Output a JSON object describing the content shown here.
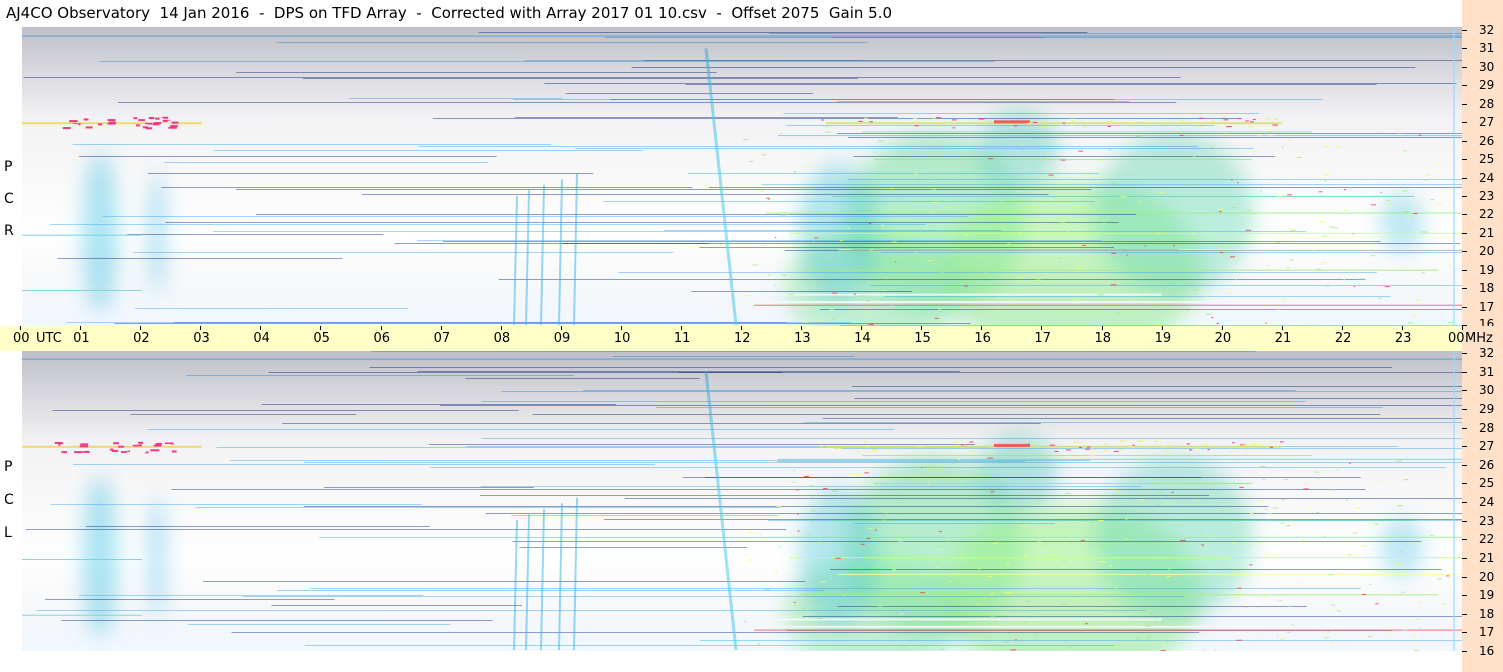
{
  "title": "AJ4CO Observatory  14 Jan 2016  -  DPS on TFD Array  -  Corrected with Array 2017 01 10.csv  -  Offset 2075  Gain 5.0",
  "chart_data": {
    "type": "heatmap",
    "title": "AJ4CO Observatory  14 Jan 2016  -  DPS on TFD Array  -  Corrected with Array 2017 01 10.csv  -  Offset 2075  Gain 5.0",
    "xlabel": "UTC",
    "ylabel": "MHz",
    "x_range": [
      0,
      24
    ],
    "y_range": [
      16,
      32
    ],
    "colormap": [
      "#00003a",
      "#0a1e8c",
      "#1450dc",
      "#1e8cff",
      "#3cc8e6",
      "#a0f08c",
      "#ffff50",
      "#ff4040",
      "#ffffff"
    ],
    "panels": [
      {
        "name": "RCP",
        "label": [
          "R",
          "C",
          "P"
        ]
      },
      {
        "name": "LCP",
        "label": [
          "L",
          "C",
          "P"
        ]
      }
    ],
    "time_ticks": [
      "00",
      "01",
      "02",
      "03",
      "04",
      "05",
      "06",
      "07",
      "08",
      "09",
      "10",
      "11",
      "12",
      "13",
      "14",
      "15",
      "16",
      "17",
      "18",
      "19",
      "20",
      "21",
      "22",
      "23",
      "00"
    ],
    "time_unit_label": "UTC",
    "freq_ticks": [
      "32",
      "31",
      "30",
      "29",
      "28",
      "27",
      "26",
      "25",
      "24",
      "23",
      "22",
      "21",
      "20",
      "19",
      "18",
      "17",
      "16"
    ],
    "freq_unit_label": "MHz"
  }
}
